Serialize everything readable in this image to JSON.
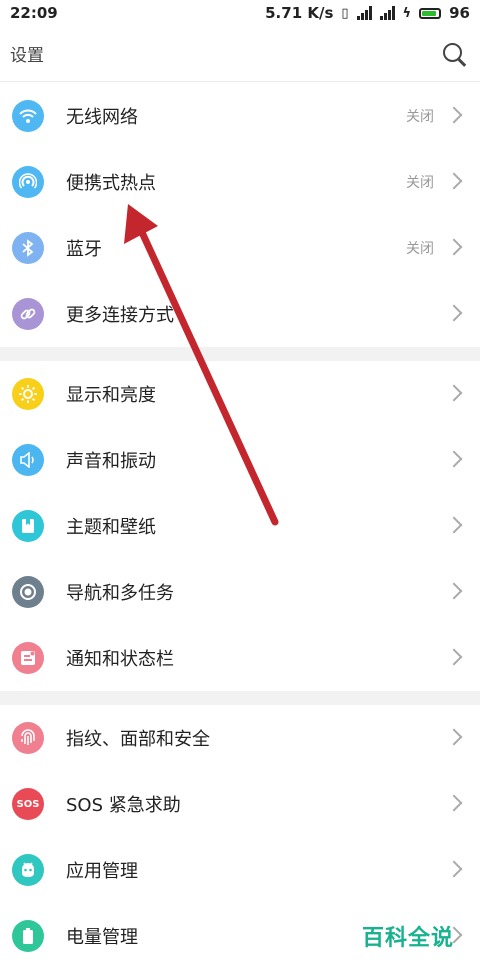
{
  "status_bar": {
    "time": "22:09",
    "net_speed": "5.71 K/s",
    "battery": "96"
  },
  "header": {
    "title": "设置"
  },
  "section1": [
    {
      "label": "无线网络",
      "status": "关闭",
      "icon": "wifi-icon",
      "color": "#4fb8f2"
    },
    {
      "label": "便携式热点",
      "status": "关闭",
      "icon": "hotspot-icon",
      "color": "#4fb8f2"
    },
    {
      "label": "蓝牙",
      "status": "关闭",
      "icon": "bluetooth-icon",
      "color": "#7eb2f0"
    },
    {
      "label": "更多连接方式",
      "status": "",
      "icon": "link-icon",
      "color": "#a994d6"
    }
  ],
  "section2": [
    {
      "label": "显示和亮度",
      "icon": "sun-icon",
      "color": "#f8cf19"
    },
    {
      "label": "声音和振动",
      "icon": "speaker-icon",
      "color": "#4cb6f0"
    },
    {
      "label": "主题和壁纸",
      "icon": "theme-icon",
      "color": "#2fc7d8"
    },
    {
      "label": "导航和多任务",
      "icon": "navigation-icon",
      "color": "#6e7f8e"
    },
    {
      "label": "通知和状态栏",
      "icon": "notification-icon",
      "color": "#f07f8f"
    }
  ],
  "section3": [
    {
      "label": "指纹、面部和安全",
      "icon": "fingerprint-icon",
      "color": "#f07f8f"
    },
    {
      "label": "SOS 紧急求助",
      "icon": "sos-icon",
      "color": "#e84b55",
      "icon_text": "SOS"
    },
    {
      "label": "应用管理",
      "icon": "app-manage-icon",
      "color": "#2fc7c0"
    },
    {
      "label": "电量管理",
      "icon": "battery-manage-icon",
      "color": "#2fc79a"
    }
  ],
  "watermark": "百科全说"
}
